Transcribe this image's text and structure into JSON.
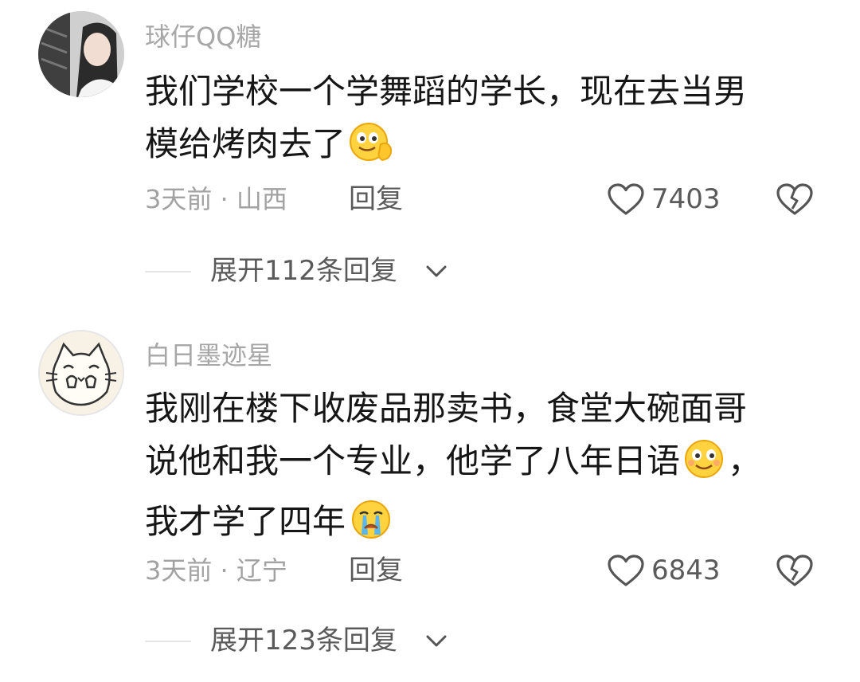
{
  "comments": [
    {
      "username": "球仔QQ糖",
      "avatar_icon": "avatar-girl-photo",
      "lines": [
        "我们学校一个学舞蹈的学长，现在去当男",
        "模给烤肉去了"
      ],
      "emojis": [
        "grinning-hand-emoji"
      ],
      "time_location": "3天前 · 山西",
      "reply_label": "回复",
      "likes": "7403",
      "expand_label": "展开112条回复"
    },
    {
      "username": "白日墨迹星",
      "avatar_icon": "avatar-cat-drawing",
      "lines": [
        "我刚在楼下收废品那卖书，食堂大碗面哥",
        "说他和我一个专业，他学了八年日语",
        "，",
        "我才学了四年"
      ],
      "emojis": [
        "smile-emoji",
        "crying-emoji"
      ],
      "time_location": "3天前 · 辽宁",
      "reply_label": "回复",
      "likes": "6843",
      "expand_label": "展开123条回复"
    }
  ],
  "colors": {
    "username": "#a7a7a7",
    "body_text": "#161616",
    "meta_text": "#a2a2a2",
    "action_text": "#5a5a5a"
  }
}
